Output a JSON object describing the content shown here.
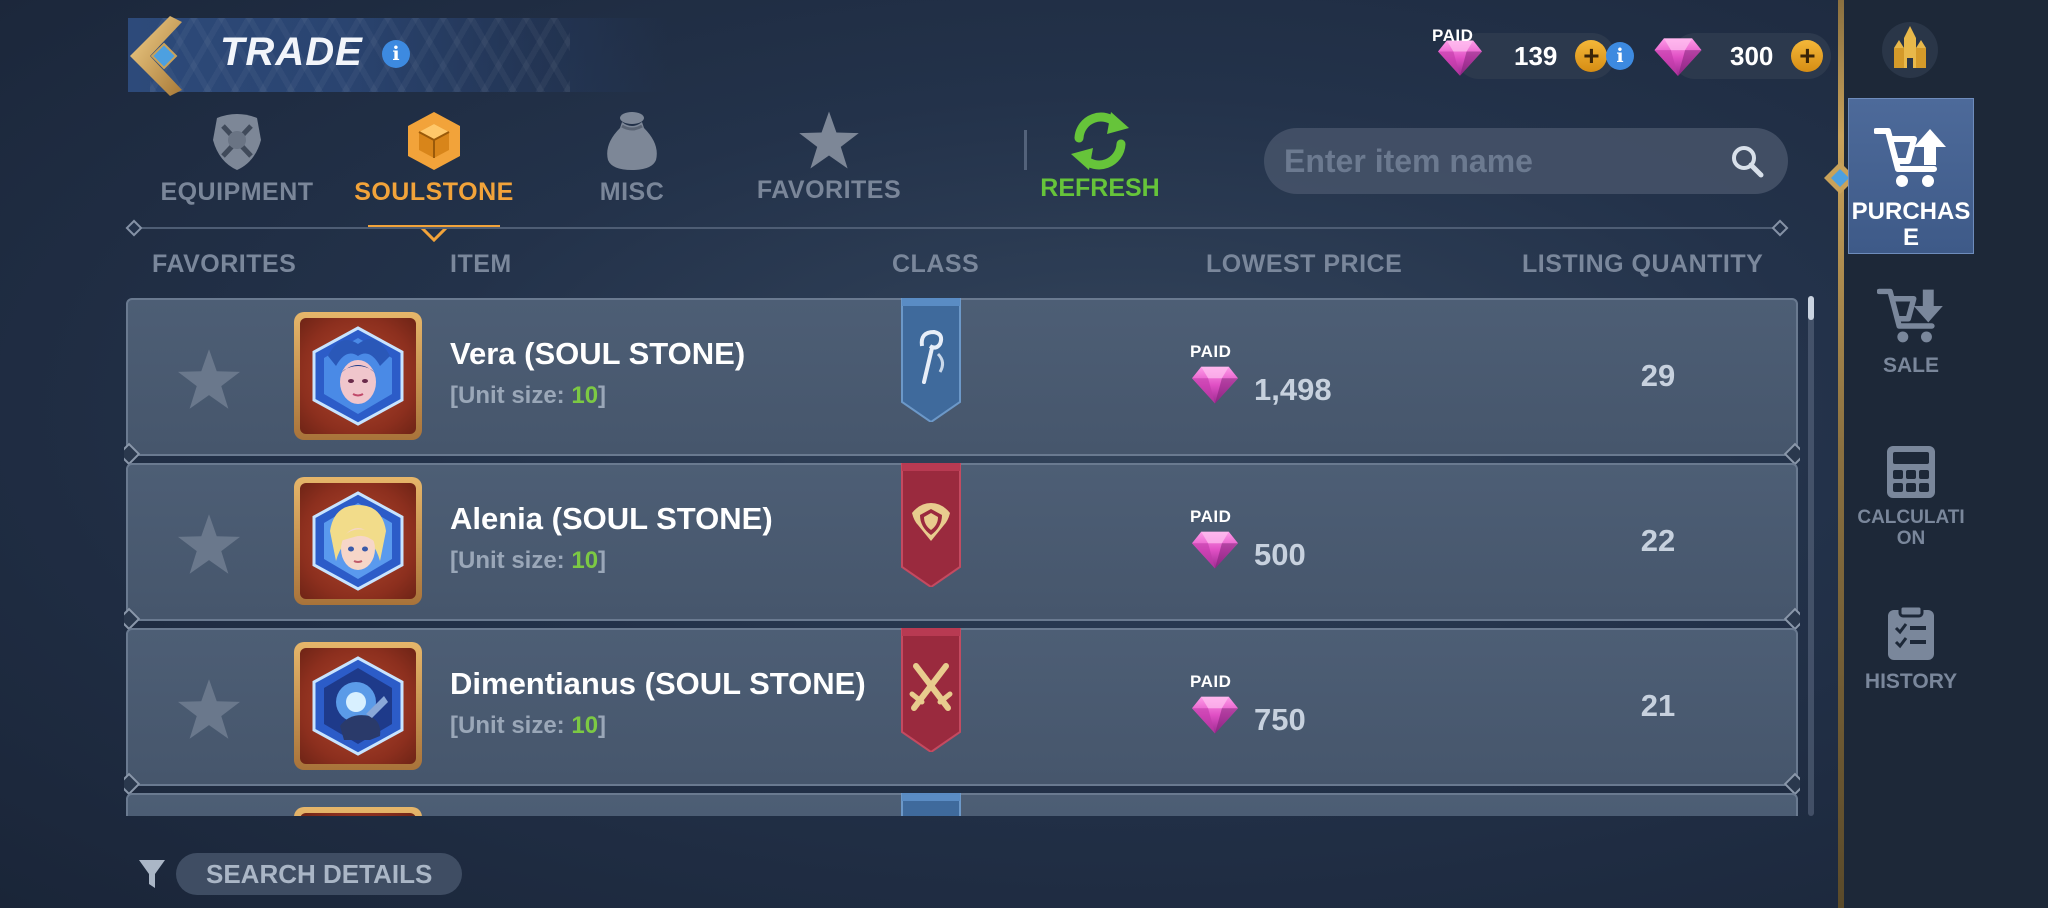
{
  "header": {
    "title": "TRADE",
    "currencies": [
      {
        "tag": "PAID",
        "value": "139"
      },
      {
        "tag": "",
        "value": "300"
      }
    ]
  },
  "tabs": [
    {
      "label": "EQUIPMENT",
      "icon": "equipment-icon",
      "active": false
    },
    {
      "label": "SOULSTONE",
      "icon": "soulstone-icon",
      "active": true
    },
    {
      "label": "MISC",
      "icon": "bag-icon",
      "active": false
    },
    {
      "label": "FAVORITES",
      "icon": "star-icon",
      "active": false
    }
  ],
  "refresh": {
    "label": "REFRESH"
  },
  "search": {
    "placeholder": "Enter item name",
    "value": ""
  },
  "columns": {
    "favorites": "FAVORITES",
    "item": "ITEM",
    "class": "CLASS",
    "lowest_price": "LOWEST PRICE",
    "listing_quantity": "LISTING QUANTITY"
  },
  "items": [
    {
      "name": "Vera (SOUL STONE)",
      "unit_prefix": "[Unit size: ",
      "unit_size": "10",
      "unit_suffix": "]",
      "class": "mage",
      "class_color": "#3f6a9c",
      "price_tag": "PAID",
      "price": "1,498",
      "quantity": "29"
    },
    {
      "name": "Alenia (SOUL STONE)",
      "unit_prefix": "[Unit size: ",
      "unit_size": "10",
      "unit_suffix": "]",
      "class": "defender",
      "class_color": "#9a2a3e",
      "price_tag": "PAID",
      "price": "500",
      "quantity": "22"
    },
    {
      "name": "Dimentianus (SOUL STONE)",
      "unit_prefix": "[Unit size: ",
      "unit_size": "10",
      "unit_suffix": "]",
      "class": "warrior",
      "class_color": "#9a2a3e",
      "price_tag": "PAID",
      "price": "750",
      "quantity": "21"
    }
  ],
  "bottom": {
    "search_details": "SEARCH DETAILS"
  },
  "sidebar": [
    {
      "label": "PURCHASE",
      "icon": "cart-upload-icon",
      "active": true
    },
    {
      "label": "SALE",
      "icon": "cart-download-icon",
      "active": false
    },
    {
      "label": "CALCULATION",
      "icon": "calculator-icon",
      "active": false
    },
    {
      "label": "HISTORY",
      "icon": "clipboard-icon",
      "active": false
    }
  ],
  "colors": {
    "accent_orange": "#f2a33a",
    "refresh_green": "#66c43a",
    "unit_green": "#7cc943",
    "gem_pink": "#e04fc4",
    "gold": "#f4b739"
  }
}
